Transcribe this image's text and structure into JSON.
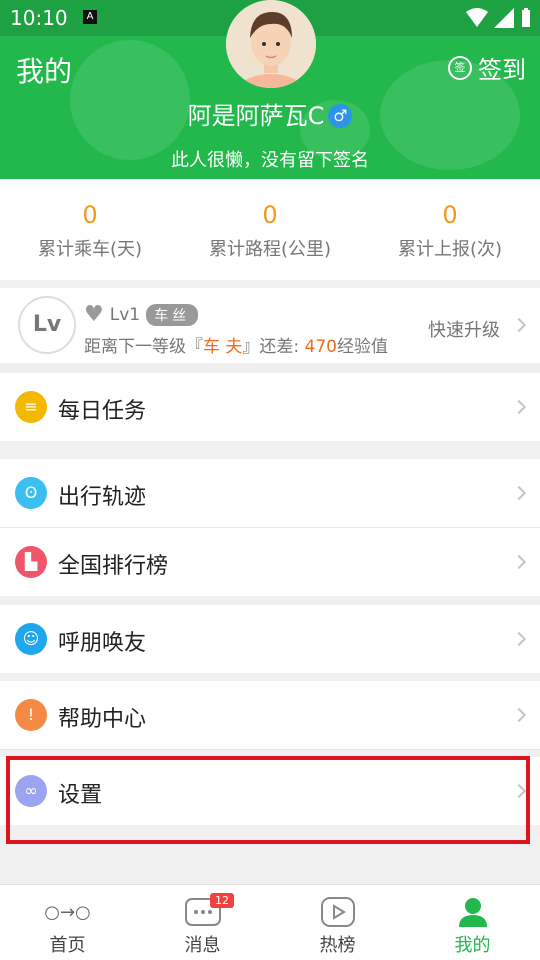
{
  "status": {
    "time": "10:10",
    "notif": "A"
  },
  "header": {
    "title": "我的",
    "signin_badge": "签",
    "signin_label": "签到",
    "username": "阿是阿萨瓦C",
    "gender": "♂",
    "signature": "此人很懒，没有留下签名",
    "bg_color": "#22b84c"
  },
  "stats": [
    {
      "value": "0",
      "label": "累计乘车(天)"
    },
    {
      "value": "0",
      "label": "累计路程(公里)"
    },
    {
      "value": "0",
      "label": "累计上报(次)"
    }
  ],
  "level": {
    "badge": "Lv",
    "level_text": "Lv1",
    "tag": "车丝",
    "desc_prefix": "距离下一等级『",
    "next_level": "车 夫",
    "desc_mid": "』还差: ",
    "points": "470",
    "desc_suffix": "经验值",
    "upgrade": "快速升级"
  },
  "menu": [
    {
      "label": "每日任务",
      "icon": "coins-icon",
      "color": "#f5b800"
    },
    {
      "label": "出行轨迹",
      "icon": "footprint-icon",
      "color": "#3bbef0"
    },
    {
      "label": "全国排行榜",
      "icon": "podium-icon",
      "color": "#f0566b"
    },
    {
      "label": "呼朋唤友",
      "icon": "friends-icon",
      "color": "#1ea7ec"
    },
    {
      "label": "帮助中心",
      "icon": "lightbulb-icon",
      "color": "#f58a45"
    },
    {
      "label": "设置",
      "icon": "settings-icon",
      "color": "#9aa4f0"
    }
  ],
  "tabs": [
    {
      "label": "首页",
      "icon": "home-route-icon"
    },
    {
      "label": "消息",
      "icon": "message-icon",
      "badge": "12"
    },
    {
      "label": "热榜",
      "icon": "play-icon"
    },
    {
      "label": "我的",
      "icon": "person-icon",
      "active": true
    }
  ]
}
